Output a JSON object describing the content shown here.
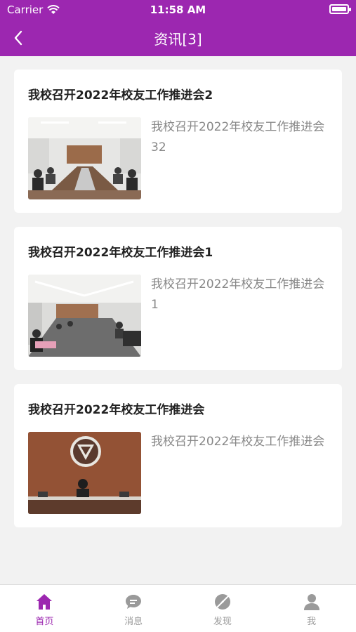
{
  "status_bar": {
    "carrier": "Carrier",
    "time": "11:58 AM"
  },
  "nav": {
    "title": "资讯[3]"
  },
  "articles": [
    {
      "title": "我校召开2022年校友工作推进会2",
      "summary": "我校召开2022年校友工作推进会32"
    },
    {
      "title": "我校召开2022年校友工作推进会1",
      "summary": "我校召开2022年校友工作推进会1"
    },
    {
      "title": "我校召开2022年校友工作推进会",
      "summary": "我校召开2022年校友工作推进会"
    }
  ],
  "tabs": [
    {
      "label": "首页",
      "icon": "home-icon",
      "active": true
    },
    {
      "label": "消息",
      "icon": "chat-bubble-icon",
      "active": false
    },
    {
      "label": "发现",
      "icon": "compass-icon",
      "active": false
    },
    {
      "label": "我",
      "icon": "person-icon",
      "active": false
    }
  ],
  "colors": {
    "accent": "#9c27b0",
    "inactive": "#9a9a9a",
    "background": "#f2f2f2"
  }
}
